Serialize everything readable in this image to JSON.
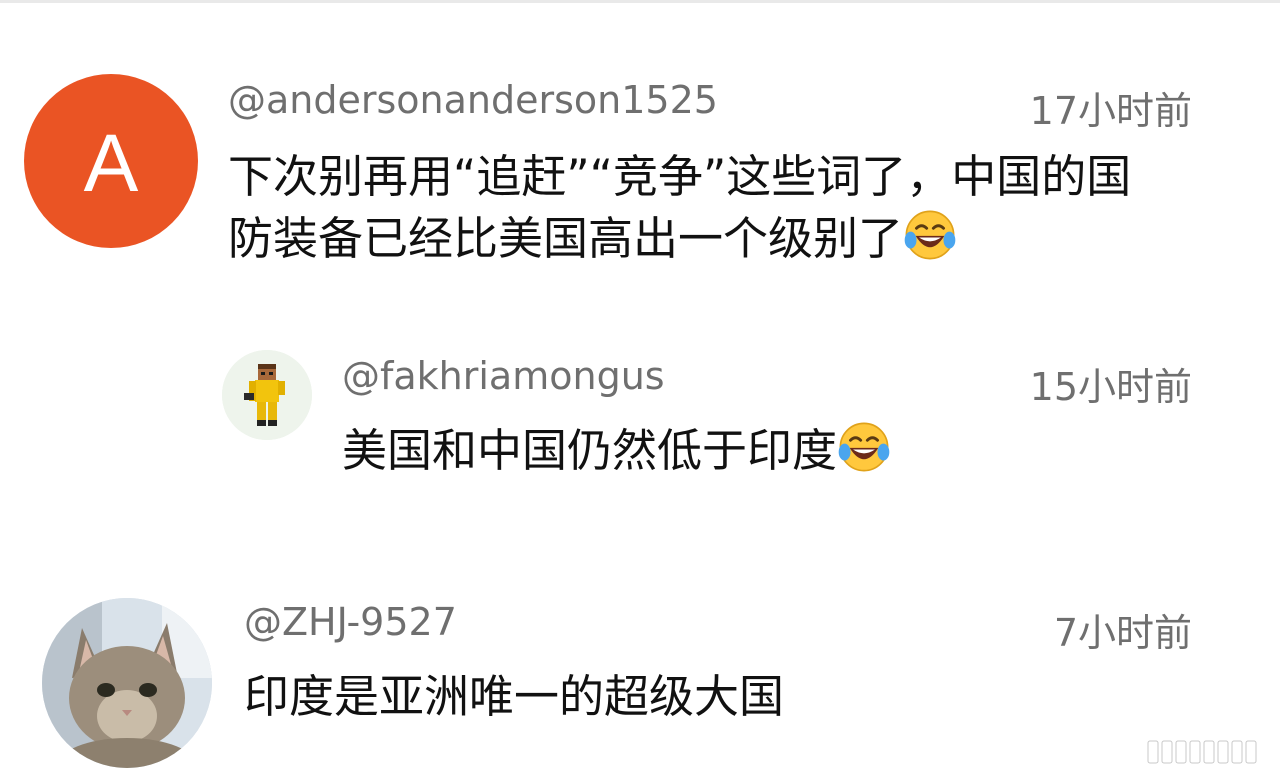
{
  "colors": {
    "avatar_a_bg": "#ea5424",
    "meta_text": "#6f6f6f",
    "body_text": "#111111"
  },
  "comments": [
    {
      "username": "@andersonanderson1525",
      "time": "17小时前",
      "avatar_letter": "A",
      "text_line1": "下次别再用“追赶”“竞争”这些词了，中国的国",
      "text_line2": "防装备已经比美国高出一个级别了",
      "emoji": "laughing-tears-icon"
    },
    {
      "username": "@fakhriamongus",
      "time": "15小时前",
      "avatar": "minecraft-character-avatar",
      "text": "美国和中国仍然低于印度",
      "emoji": "laughing-tears-icon"
    },
    {
      "username": "@ZHJ-9527",
      "time": "7小时前",
      "avatar": "cat-avatar",
      "text": "印度是亚洲唯一的超级大国"
    }
  ]
}
